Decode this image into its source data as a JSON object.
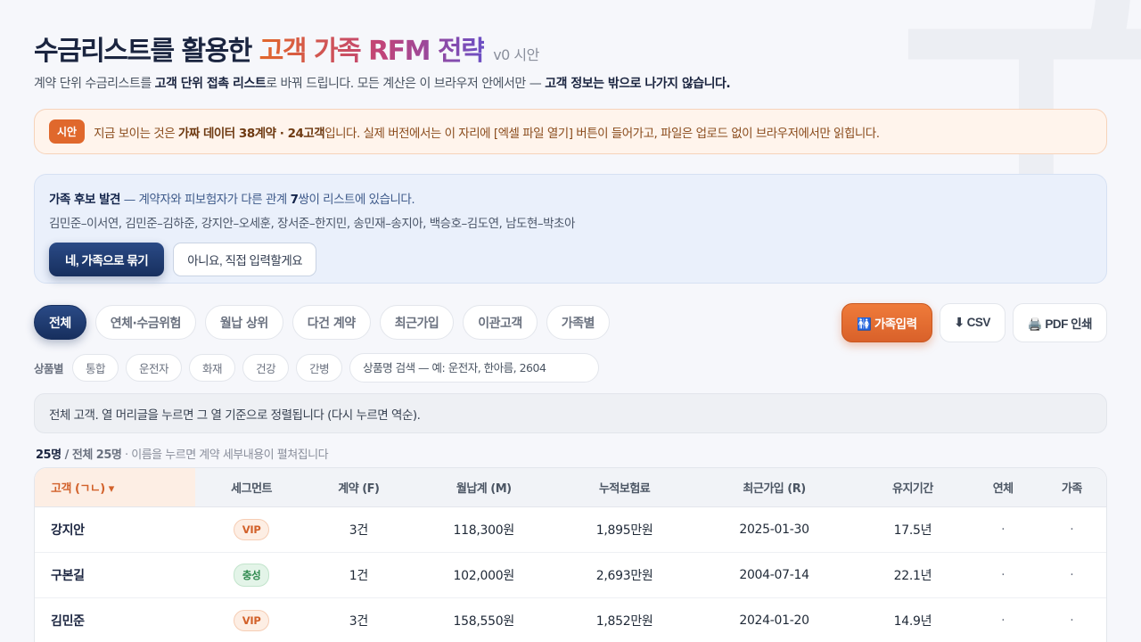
{
  "header": {
    "title_prefix": "수금리스트를 활용한 ",
    "title_accent": "고객 가족 RFM 전략",
    "version": "v0 시안",
    "subtitle_parts": [
      "계약 단위 수금리스트를 ",
      "고객 단위 접촉 리스트",
      "로 바꿔 드립니다. 모든 계산은 이 브라우저 안에서만 — ",
      "고객 정보는 밖으로 나가지 않습니다."
    ]
  },
  "notice": {
    "badge": "시안",
    "text_parts": [
      "지금 보이는 것은 ",
      "가짜 데이터 38계약 · 24고객",
      "입니다. 실제 버전에서는 이 자리에 [엑셀 파일 열기] 버튼이 들어가고, 파일은 업로드 없이 브라우저에서만 읽힙니다."
    ]
  },
  "family_panel": {
    "title": "가족 후보 발견",
    "line1_parts": [
      " — 계약자와 피보험자가 다른 관계 ",
      "7",
      "쌍이 리스트에 있습니다."
    ],
    "pairs": "김민준–이서연, 김민준–김하준, 강지안–오세훈, 장서준–한지민, 송민재–송지아, 백승호–김도연, 남도현–박초아",
    "confirm_label": "네, 가족으로 묶기",
    "decline_label": "아니요, 직접 입력할게요"
  },
  "tabs": [
    "전체",
    "연체·수금위험",
    "월납 상위",
    "다건 계약",
    "최근가입",
    "이관고객",
    "가족별"
  ],
  "active_tab": 0,
  "actions": {
    "family_input": "🚻 가족입력",
    "csv": "⬇ CSV",
    "pdf": "🖨️ PDF 인쇄"
  },
  "filters": {
    "label": "상품별",
    "chips": [
      "통합",
      "운전자",
      "화재",
      "건강",
      "간병"
    ],
    "search_placeholder": "상품명 검색 — 예: 운전자, 한아름, 2604"
  },
  "info_text": "전체 고객. 열 머리글을 누르면 그 열 기준으로 정렬됩니다 (다시 누르면 역순).",
  "count": {
    "shown": "25명",
    "total": " / 전체 25명",
    "hint": " · 이름을 누르면 계약 세부내용이 펼쳐집니다"
  },
  "table": {
    "columns": [
      "고객 (ㄱㄴ) ▾",
      "세그먼트",
      "계약 (F)",
      "월납계 (M)",
      "누적보험료",
      "최근가입 (R)",
      "유지기간",
      "연체",
      "가족"
    ],
    "rows": [
      {
        "name": "강지안",
        "segment": "VIP",
        "seg_type": "vip",
        "contracts": "3건",
        "monthly": "118,300원",
        "cumulative": "1,895만원",
        "recent": "2025-01-30",
        "tenure": "17.5년",
        "overdue": "·",
        "family": "·"
      },
      {
        "name": "구본길",
        "segment": "충성",
        "seg_type": "loyal",
        "contracts": "1건",
        "monthly": "102,000원",
        "cumulative": "2,693만원",
        "recent": "2004-07-14",
        "tenure": "22.1년",
        "overdue": "·",
        "family": "·"
      },
      {
        "name": "김민준",
        "segment": "VIP",
        "seg_type": "vip",
        "contracts": "3건",
        "monthly": "158,550원",
        "cumulative": "1,852만원",
        "recent": "2024-01-20",
        "tenure": "14.9년",
        "overdue": "·",
        "family": "·"
      }
    ]
  }
}
